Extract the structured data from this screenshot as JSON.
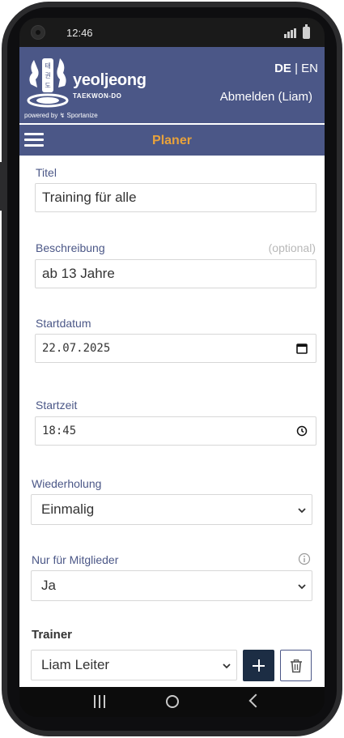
{
  "status_bar": {
    "time": "12:46"
  },
  "header": {
    "brand": "yeoljeong",
    "brand_sub": "TAEKWON-DO",
    "powered_by": "powered by ↯ Sportanize",
    "lang_active": "DE",
    "lang_separator": " | ",
    "lang_other": "EN",
    "logout_label": "Abmelden (Liam)"
  },
  "navbar": {
    "title": "Planer"
  },
  "form": {
    "title": {
      "label": "Titel",
      "value": "Training für alle"
    },
    "description": {
      "label": "Beschreibung",
      "optional": "(optional)",
      "value": "ab 13 Jahre"
    },
    "start_date": {
      "label": "Startdatum",
      "value": "22.07.2025"
    },
    "start_time": {
      "label": "Startzeit",
      "value": "18:45"
    },
    "repeat": {
      "label": "Wiederholung",
      "value": "Einmalig"
    },
    "members_only": {
      "label": "Nur für Mitglieder",
      "value": "Ja"
    },
    "trainer": {
      "label": "Trainer",
      "value": "Liam Leiter"
    }
  },
  "colors": {
    "header_bg": "#4b5787",
    "accent": "#e8a23b",
    "add_button": "#1c2d44"
  },
  "icons": {
    "menu": "hamburger-icon",
    "calendar": "calendar-icon",
    "clock": "clock-icon",
    "info": "info-icon",
    "dropdown": "chevron-down-icon",
    "add": "plus-icon",
    "delete": "trash-icon"
  }
}
